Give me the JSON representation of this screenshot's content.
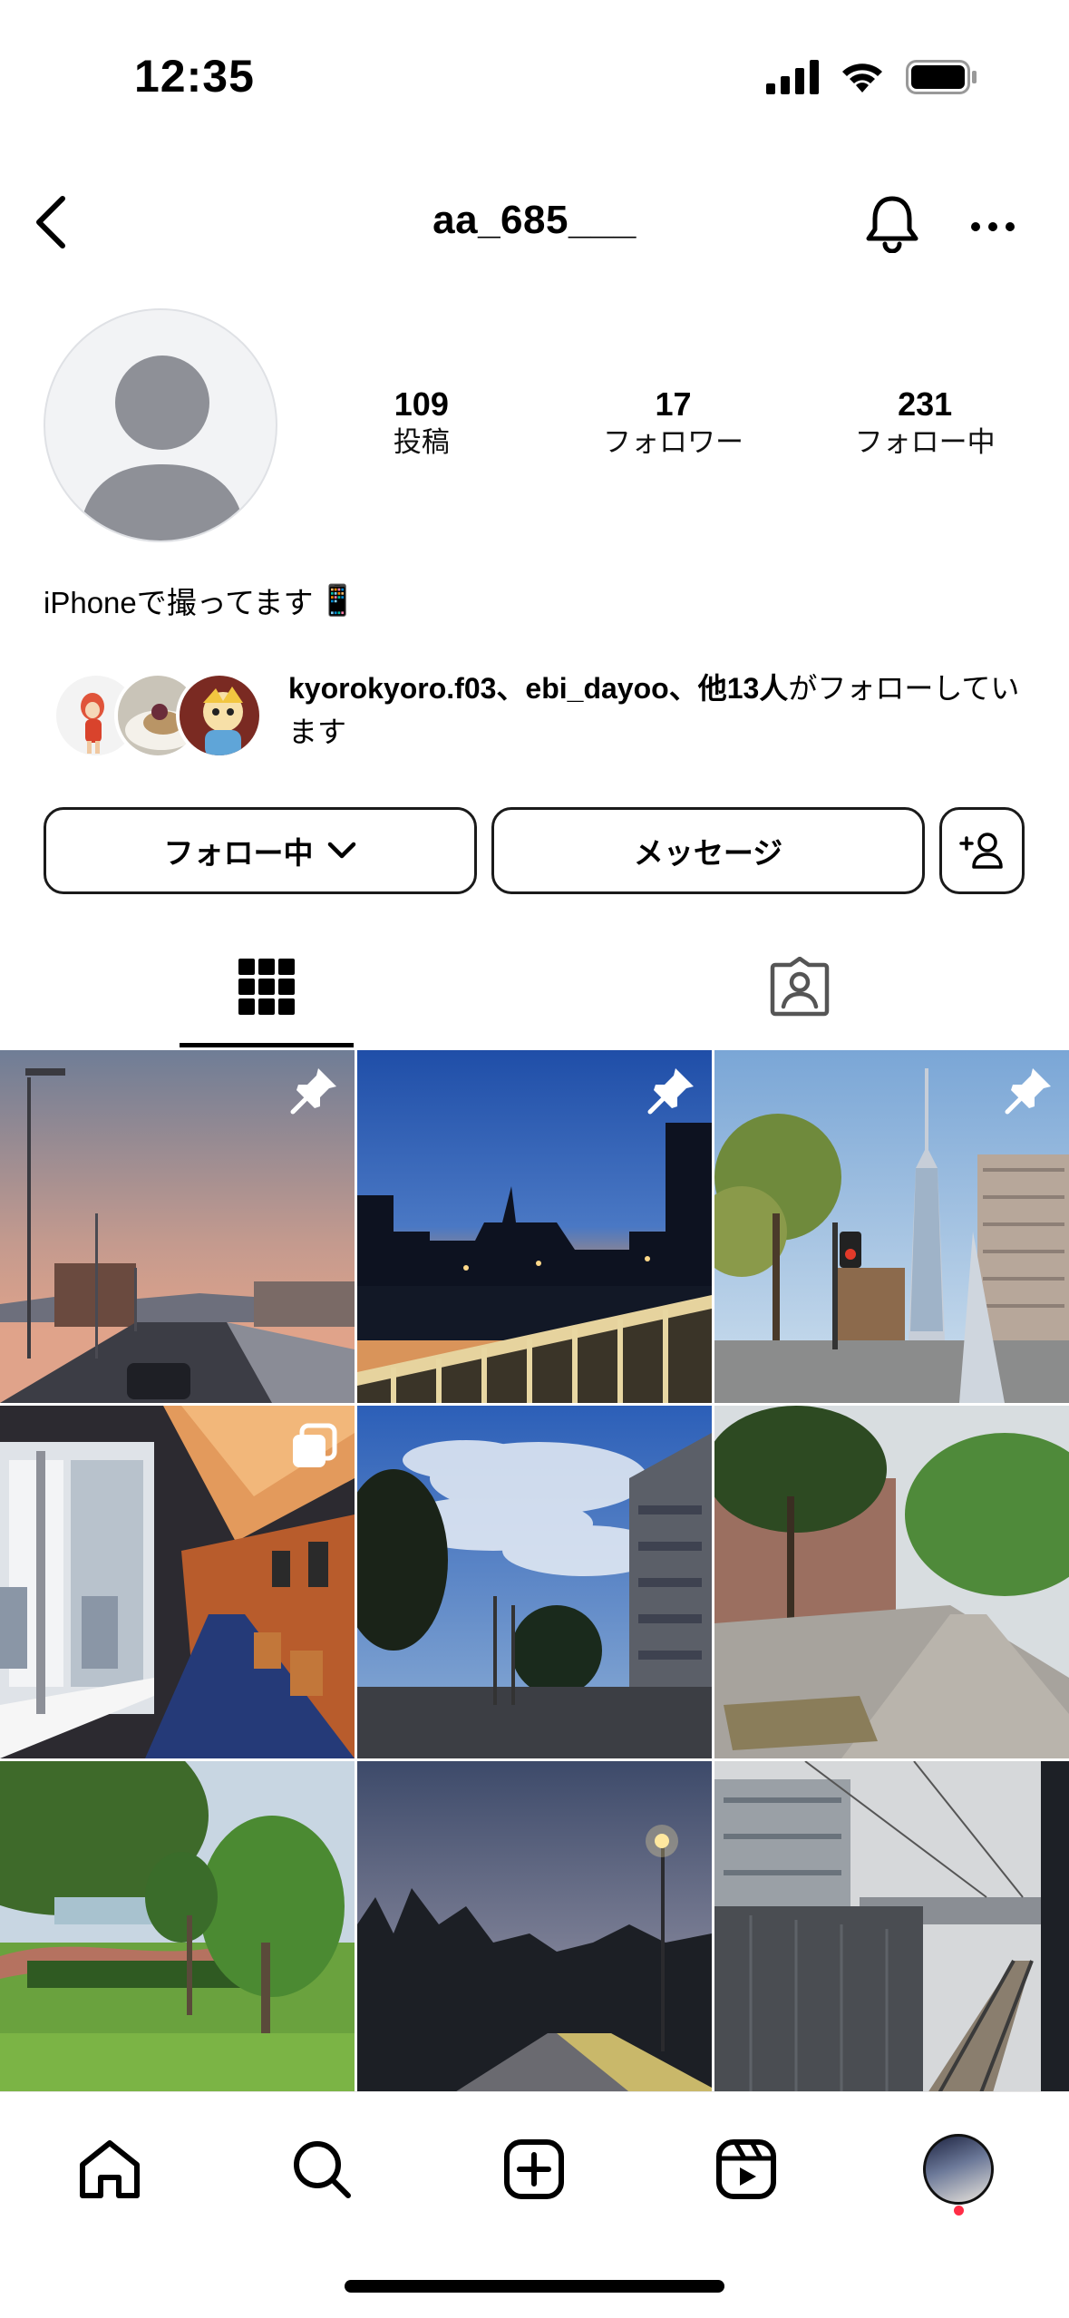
{
  "status_bar": {
    "time": "12:35"
  },
  "header": {
    "username": "aa_685___"
  },
  "profile": {
    "stats": [
      {
        "count": "109",
        "label": "投稿"
      },
      {
        "count": "17",
        "label": "フォロワー"
      },
      {
        "count": "231",
        "label": "フォロー中"
      }
    ],
    "bio_text": "iPhoneで撮ってます",
    "bio_emoji": "📱",
    "followed_by_names": "kyorokyoro.f03、ebi_dayoo、",
    "followed_by_rest": "他13人",
    "followed_by_suffix": "がフォローしています"
  },
  "actions": {
    "following_label": "フォロー中",
    "message_label": "メッセージ"
  },
  "tabs": [
    {
      "icon": "grid-icon",
      "active": true
    },
    {
      "icon": "tagged-person-icon",
      "active": false
    }
  ],
  "posts": [
    {
      "scene": "sunset-highway",
      "badge": "pin-icon"
    },
    {
      "scene": "night-city-bridge",
      "badge": "pin-icon"
    },
    {
      "scene": "fukuoka-tower",
      "badge": "pin-icon"
    },
    {
      "scene": "train-interior",
      "badge": "carousel-icon"
    },
    {
      "scene": "cloudy-sky-street",
      "badge": ""
    },
    {
      "scene": "tree-sidewalk",
      "badge": ""
    },
    {
      "scene": "park-green",
      "badge": ""
    },
    {
      "scene": "dusk-park-path",
      "badge": ""
    },
    {
      "scene": "railway-tracks",
      "badge": ""
    }
  ],
  "bottom_nav": [
    "home-icon",
    "search-icon",
    "create-icon",
    "reels-icon",
    "profile-avatar"
  ],
  "colors": {
    "accent_dot": "#ff2d46",
    "border": "#1a1a1a",
    "avatar_gray": "#8e9097"
  }
}
